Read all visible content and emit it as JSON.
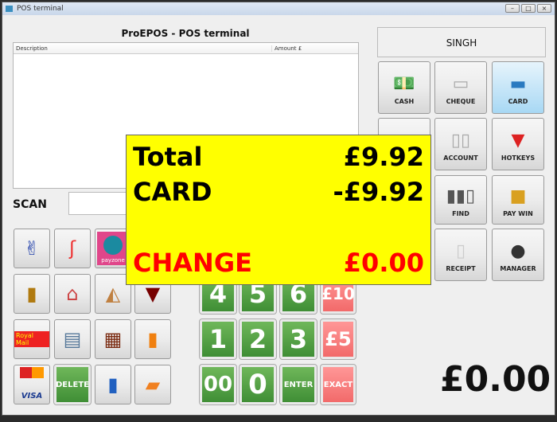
{
  "window": {
    "title": "POS terminal"
  },
  "header": {
    "title": "ProEPOS - POS terminal"
  },
  "table": {
    "columns": [
      "Description",
      "Amount £"
    ],
    "rows": []
  },
  "scan": {
    "label": "SCAN",
    "value": ""
  },
  "operator": "SINGH",
  "payment_buttons": [
    {
      "label": "CASH",
      "icon": "cash-icon"
    },
    {
      "label": "CHEQUE",
      "icon": "cheque-icon"
    },
    {
      "label": "CARD",
      "icon": "card-icon"
    },
    {
      "label": "",
      "icon": "folder-icon"
    },
    {
      "label": "ACCOUNT",
      "icon": "account-book-icon"
    },
    {
      "label": "HOTKEYS",
      "icon": "basket-icon"
    },
    {
      "label": "FIND",
      "icon": "barcode-search-icon"
    },
    {
      "label": "PAY WIN",
      "icon": "treasure-chest-icon"
    },
    {
      "label": "RECEIPT",
      "icon": "receipt-icon"
    },
    {
      "label": "MANAGER",
      "icon": "manager-icon"
    }
  ],
  "product_buttons": [
    {
      "icon": "lottery-icon"
    },
    {
      "icon": "candy-cane-icon"
    },
    {
      "icon": "payzone-icon",
      "text": "payzone"
    },
    {
      "icon": "whisky-bottle-icon"
    },
    {
      "icon": "house-icon"
    },
    {
      "icon": "sandwich-icon"
    },
    {
      "icon": "wine-glass-icon"
    },
    {
      "icon": "royal-mail-icon",
      "text": "Royal Mail"
    },
    {
      "icon": "newspaper-icon"
    },
    {
      "icon": "shop-icon"
    },
    {
      "icon": "soft-drink-icon"
    },
    {
      "icon": "mastercard-visa-icon",
      "text": "VISA"
    },
    {
      "label": "DELETE"
    },
    {
      "icon": "milk-icon"
    },
    {
      "icon": "bread-icon"
    }
  ],
  "keypad": [
    {
      "label": "4"
    },
    {
      "label": "5"
    },
    {
      "label": "6"
    },
    {
      "label": "£10"
    },
    {
      "label": "1"
    },
    {
      "label": "2"
    },
    {
      "label": "3"
    },
    {
      "label": "£5"
    },
    {
      "label": "00"
    },
    {
      "label": "0"
    },
    {
      "label": "ENTER"
    },
    {
      "label": "EXACT"
    }
  ],
  "summary": {
    "total_label": "Total",
    "total_value": "£9.92",
    "card_label": "CARD",
    "card_value": "-£9.92",
    "change_label": "CHANGE",
    "change_value": "£0.00"
  },
  "display_total": "£0.00",
  "colors": {
    "overlay": "#ffff00",
    "change": "#ff0000",
    "keypad_green": "#4f9e40",
    "keypad_red": "#f47a7a"
  }
}
